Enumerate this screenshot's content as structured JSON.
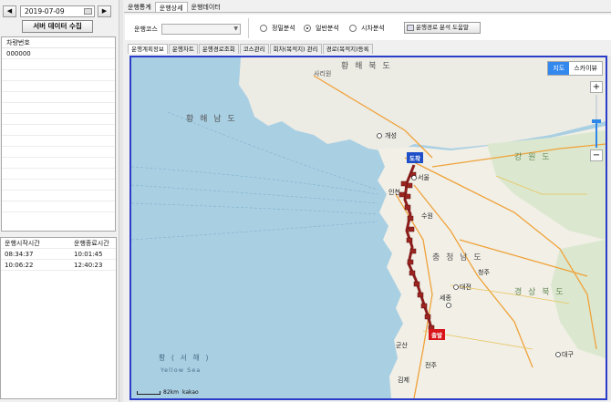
{
  "left": {
    "prev_icon": "◀",
    "next_icon": "▶",
    "date": "2019-07-09",
    "calendar_icon": "calendar-icon",
    "collect_button": "서버 데이터 수집",
    "vehicle_header": "차량번호",
    "vehicles": [
      "000000"
    ],
    "times_header_start": "운행시작시간",
    "times_header_end": "운행종료시간",
    "times": [
      {
        "start": "08:34:37",
        "end": "10:01:45"
      },
      {
        "start": "10:06:22",
        "end": "12:40:23"
      }
    ]
  },
  "top_tabs": [
    "운행통계",
    "운행상세",
    "운행데이터"
  ],
  "filter": {
    "course_label": "운행코스",
    "course_value": "",
    "radio_options": [
      "정밀분석",
      "일반분석",
      "시차분석"
    ],
    "selected_radio": "일반분석",
    "help_button": "운행경로 분석 도움말"
  },
  "sub_tabs": [
    "운행계획정보",
    "운행차트",
    "운행경로조회",
    "코스관리",
    "회차(목적지) 관리",
    "경로(목적지)등록"
  ],
  "map": {
    "type_options": [
      "지도",
      "스카이뷰"
    ],
    "active_type": "지도",
    "zoom_in": "+",
    "zoom_out": "−",
    "zoom_level": 0.5,
    "scale_text": "82km",
    "brand": "kakao",
    "start_label": "출발",
    "end_label": "도착",
    "labels": {
      "hwanghae": "황 해 남 도",
      "hwanghae_bukdo": "황 해 북 도",
      "sariwon": "사리원",
      "gaeseong": "개성",
      "gangwon": "강 원 도",
      "seoul": "서울",
      "incheon": "인천",
      "suwon": "수원",
      "daejeon": "대전",
      "sejong": "세종",
      "cheongju": "청주",
      "chungnam": "충 청 남 도",
      "gyeongbuk": "경 상 북 도",
      "daegu": "대구",
      "jeonju": "전주",
      "gunsan": "군산",
      "gimje": "김제",
      "yellow_sea": "황 ( 서 해 )",
      "yellow_sea_en": "Yellow Sea"
    }
  }
}
